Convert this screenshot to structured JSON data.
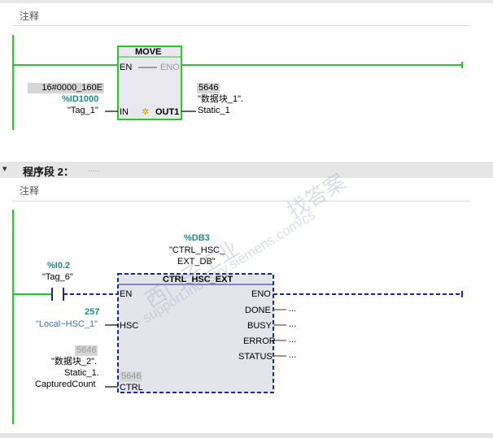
{
  "network1": {
    "comment_label": "注释",
    "move": {
      "title": "MOVE",
      "en": "EN",
      "eno": "ENO",
      "in": "IN",
      "out1": "OUT1",
      "in_value": "16#0000_160E",
      "in_addr": "%ID1000",
      "in_tag": "\"Tag_1\"",
      "out_value": "5646",
      "out_tag_1": "\"数据块_1\".",
      "out_tag_2": "Static_1"
    }
  },
  "network2": {
    "header": "程序段 2：",
    "header_dots": ".....",
    "comment_label": "注释",
    "contact": {
      "addr": "%I0.2",
      "tag": "\"Tag_6\""
    },
    "instance": {
      "addr": "%DB3",
      "name_1": "\"CTRL_HSC_",
      "name_2": "EXT_DB\""
    },
    "block": {
      "title": "CTRL_HSC_EXT",
      "en": "EN",
      "eno": "ENO",
      "hsc": "HSC",
      "ctrl": "CTRL",
      "done": "DONE",
      "busy": "BUSY",
      "error": "ERROR",
      "status": "STATUS",
      "ellipsis": "...",
      "hsc_value": "257",
      "hsc_tag": "\"Local~HSC_1\"",
      "ctrl_value": "5646",
      "ctrl_tag_1": "\"数据块_2\".",
      "ctrl_tag_2": "Static_1.",
      "ctrl_tag_3": "CapturedCount",
      "ctrl_inner_value": "5646"
    }
  },
  "watermark": {
    "text1": "西门子工业",
    "text2": "找答案",
    "text3": "support.industry.siemens.com/cs"
  },
  "colors": {
    "power_green": "#22cc22",
    "flow_blue": "#1a2a9a",
    "teal": "#1f8a8a",
    "network_header_bg": "#e6e6e6"
  }
}
